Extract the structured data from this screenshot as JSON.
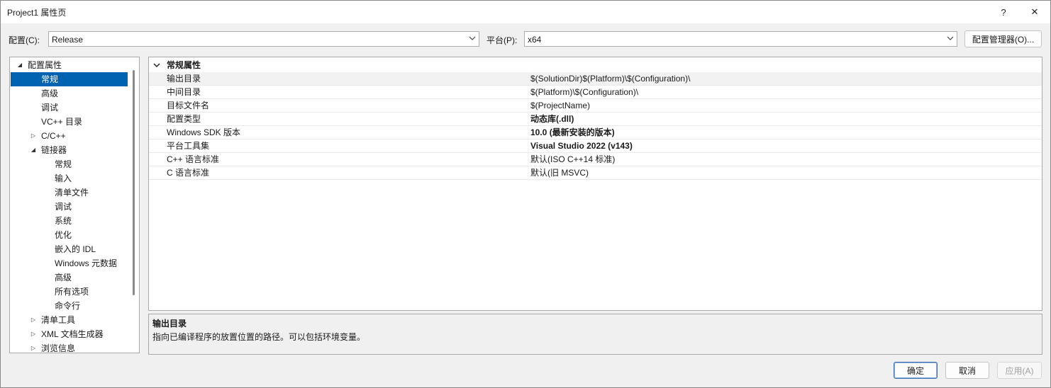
{
  "window": {
    "title": "Project1 属性页",
    "help_glyph": "?",
    "close_glyph": "✕"
  },
  "config_bar": {
    "config_label": "配置(C):",
    "config_value": "Release",
    "platform_label": "平台(P):",
    "platform_value": "x64",
    "manager_button": "配置管理器(O)..."
  },
  "tree": {
    "items": [
      {
        "label": "配置属性",
        "expander": "◢"
      },
      {
        "label": "常规"
      },
      {
        "label": "高级"
      },
      {
        "label": "调试"
      },
      {
        "label": "VC++ 目录"
      },
      {
        "label": "C/C++",
        "expander": "▷"
      },
      {
        "label": "链接器",
        "expander": "◢"
      },
      {
        "label": "常规"
      },
      {
        "label": "输入"
      },
      {
        "label": "清单文件"
      },
      {
        "label": "调试"
      },
      {
        "label": "系统"
      },
      {
        "label": "优化"
      },
      {
        "label": "嵌入的 IDL"
      },
      {
        "label": "Windows 元数据"
      },
      {
        "label": "高级"
      },
      {
        "label": "所有选项"
      },
      {
        "label": "命令行"
      },
      {
        "label": "清单工具",
        "expander": "▷"
      },
      {
        "label": "XML 文档生成器",
        "expander": "▷"
      },
      {
        "label": "浏览信息",
        "expander": "▷"
      }
    ]
  },
  "grid": {
    "section_title": "常规属性",
    "rows": [
      {
        "name": "输出目录",
        "value": "$(SolutionDir)$(Platform)\\$(Configuration)\\"
      },
      {
        "name": "中间目录",
        "value": "$(Platform)\\$(Configuration)\\"
      },
      {
        "name": "目标文件名",
        "value": "$(ProjectName)"
      },
      {
        "name": "配置类型",
        "value": "动态库(.dll)"
      },
      {
        "name": "Windows SDK 版本",
        "value": "10.0 (最新安装的版本)"
      },
      {
        "name": "平台工具集",
        "value": "Visual Studio 2022 (v143)"
      },
      {
        "name": "C++ 语言标准",
        "value": "默认(ISO C++14 标准)"
      },
      {
        "name": "C 语言标准",
        "value": "默认(旧 MSVC)"
      }
    ]
  },
  "description": {
    "title": "输出目录",
    "text": "指向已编译程序的放置位置的路径。可以包括环境变量。"
  },
  "footer": {
    "ok": "确定",
    "cancel": "取消",
    "apply": "应用(A)"
  }
}
